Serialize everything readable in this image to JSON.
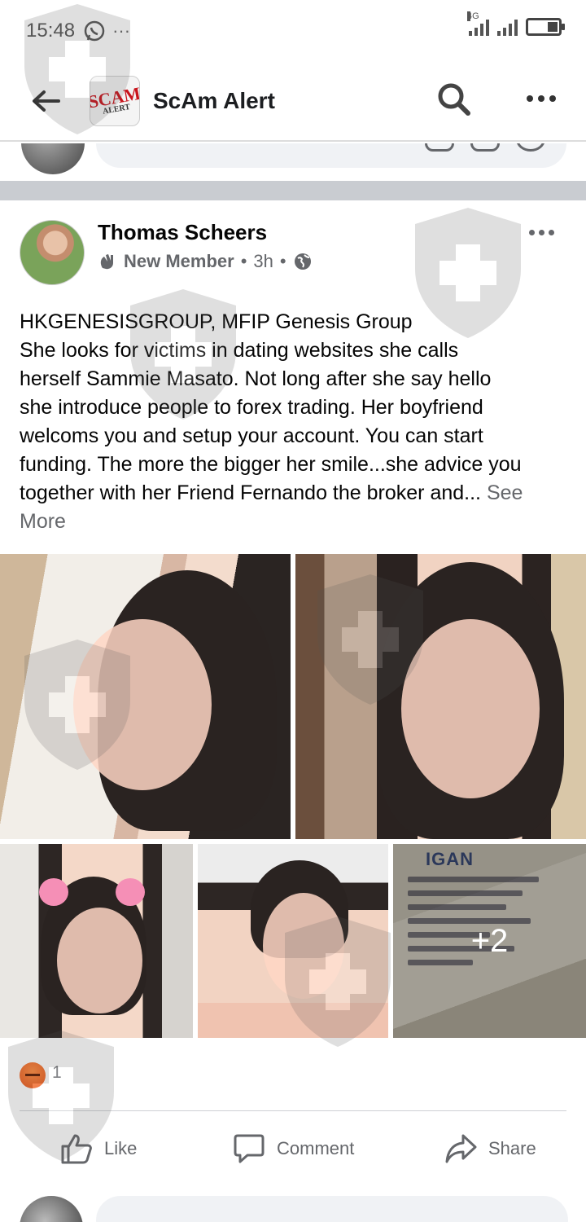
{
  "status_bar": {
    "time": "15:48",
    "overflow": "···",
    "network": "4G"
  },
  "header": {
    "back_icon": "back-arrow-icon",
    "group_logo_text": "SCAM",
    "group_logo_subtext": "ALERT",
    "title": "ScAm Alert",
    "search_icon": "search-icon",
    "more_icon": "more-icon"
  },
  "post": {
    "author": "Thomas Scheers",
    "role": "New Member",
    "time": "3h",
    "audience_icon": "globe-icon",
    "text_lines": [
      "HKGENESISGROUP,  MFIP Genesis Group",
      "She looks for victims in dating websites she calls",
      "herself Sammie Masato.  Not long after she say hello",
      "she introduce people to forex trading.  Her boyfriend",
      "welcoms you and setup your account.  You can start",
      "funding.  The more the bigger her smile...she advice you",
      "together with her Friend Fernando the broker and..."
    ],
    "see_more_1": "See",
    "see_more_2": "More",
    "photos": {
      "license_title": "IGAN",
      "more_count": "+2"
    },
    "reaction": {
      "type": "angry-reaction-icon",
      "count": "1"
    },
    "actions": {
      "like": "Like",
      "comment": "Comment",
      "share": "Share"
    }
  },
  "next_comment": {
    "placeholder_dots": "···"
  },
  "colors": {
    "text": "#050505",
    "secondary": "#65676b",
    "divider": "#c9ccd1",
    "input_bg": "#f0f2f5",
    "logo_red": "#c8141c"
  }
}
